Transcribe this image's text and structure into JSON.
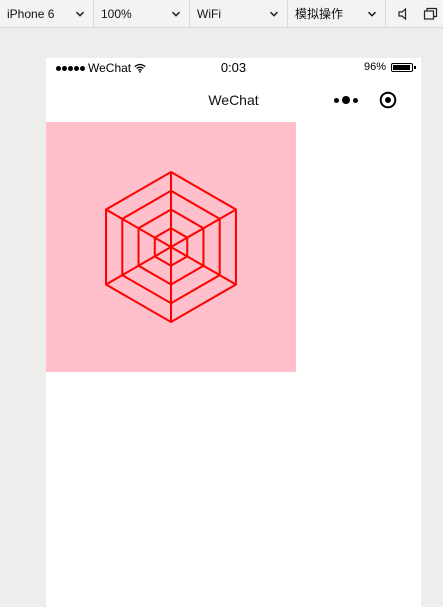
{
  "toolbar": {
    "device": "iPhone 6",
    "zoom": "100%",
    "network": "WiFi",
    "operation": "模拟操作"
  },
  "statusbar": {
    "carrier": "WeChat",
    "time": "0:03",
    "battery_text": "96%",
    "battery_level": 0.96
  },
  "navbar": {
    "title": "WeChat"
  },
  "canvas": {
    "background": "#ffc0cb",
    "stroke": "#ff0000",
    "shape": "concentric hexagons with spokes",
    "rings": 4
  },
  "colors": {
    "toolbar_bg": "#f3f3f3",
    "page_bg": "#ededeb",
    "phone_bg": "#ffffff"
  }
}
